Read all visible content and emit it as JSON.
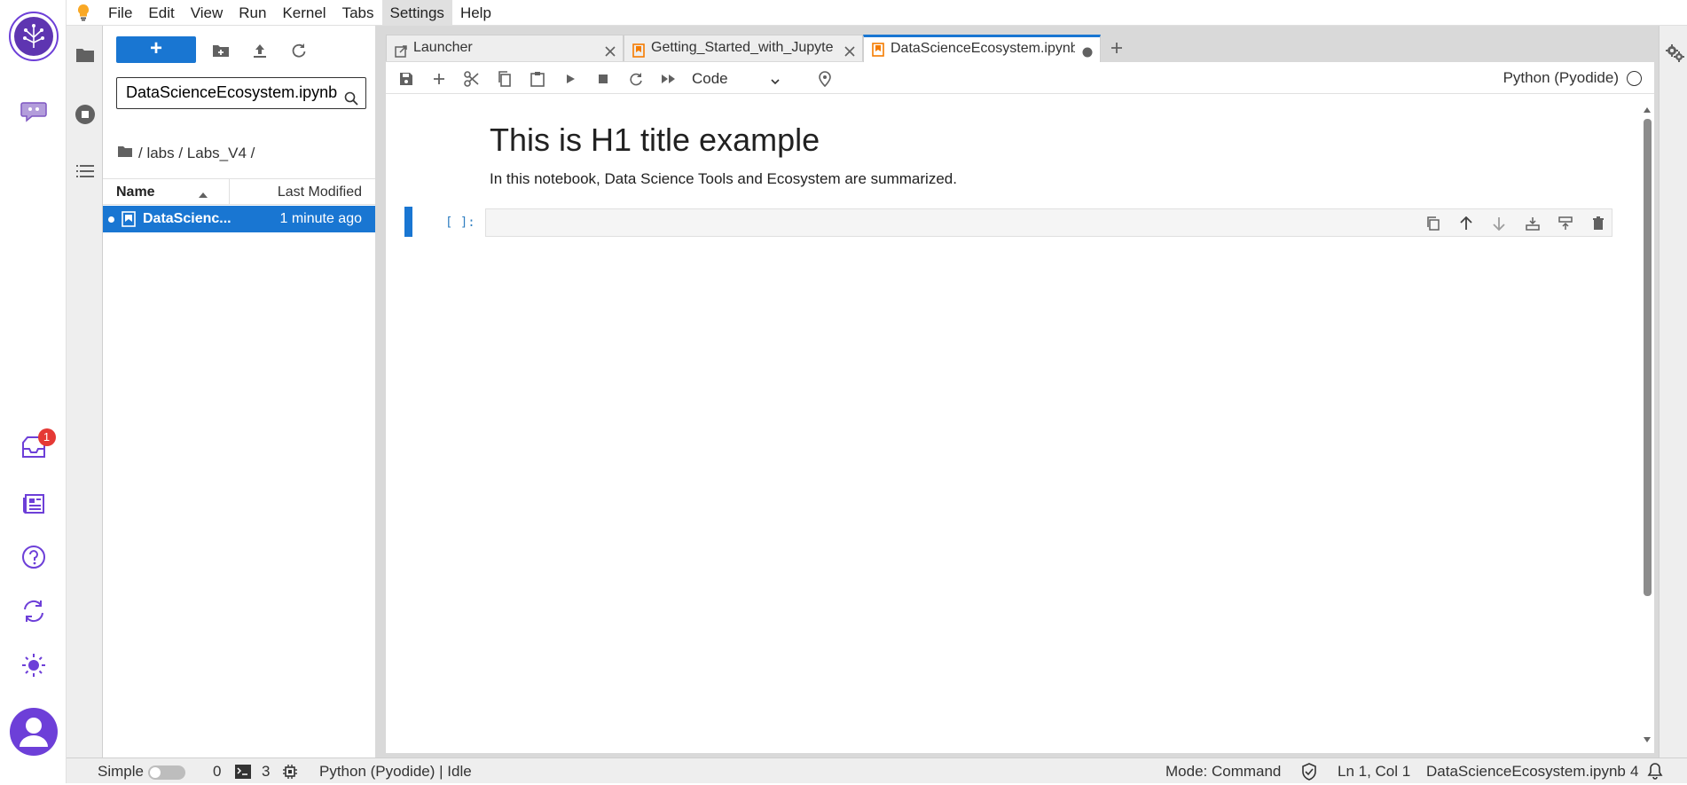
{
  "menu": {
    "items": [
      "File",
      "Edit",
      "View",
      "Run",
      "Kernel",
      "Tabs",
      "Settings",
      "Help"
    ],
    "active": "Settings"
  },
  "rail": {
    "notification_count": "1"
  },
  "filebrowser": {
    "new_label": "+",
    "search_value": "DataScienceEcosystem.ipynb",
    "breadcrumb": "/ labs / Labs_V4 /",
    "col_name": "Name",
    "col_modified": "Last Modified",
    "rows": [
      {
        "name": "DataScienc...",
        "modified": "1 minute ago"
      }
    ]
  },
  "tabs": [
    {
      "label": "Launcher"
    },
    {
      "label": "Getting_Started_with_Jupyte"
    },
    {
      "label": "DataScienceEcosystem.ipynb"
    }
  ],
  "notebook": {
    "cell_type": "Code",
    "kernel_name": "Python (Pyodide)",
    "h1": "This is H1 title example",
    "paragraph": "In this notebook, Data Science Tools and Ecosystem are summarized.",
    "prompt": "[ ]:"
  },
  "status": {
    "mode_label": "Simple",
    "terminals": "0",
    "kernels": "3",
    "kernel_status": "Python (Pyodide) | Idle",
    "mode": "Mode: Command",
    "cursor": "Ln 1, Col 1",
    "filename": "DataScienceEcosystem.ipynb",
    "notifications": "4"
  },
  "colors": {
    "accent": "#1976d2",
    "rail_purple": "#6d3fd8",
    "tab_orange": "#f57c00",
    "badge_red": "#e53935"
  }
}
